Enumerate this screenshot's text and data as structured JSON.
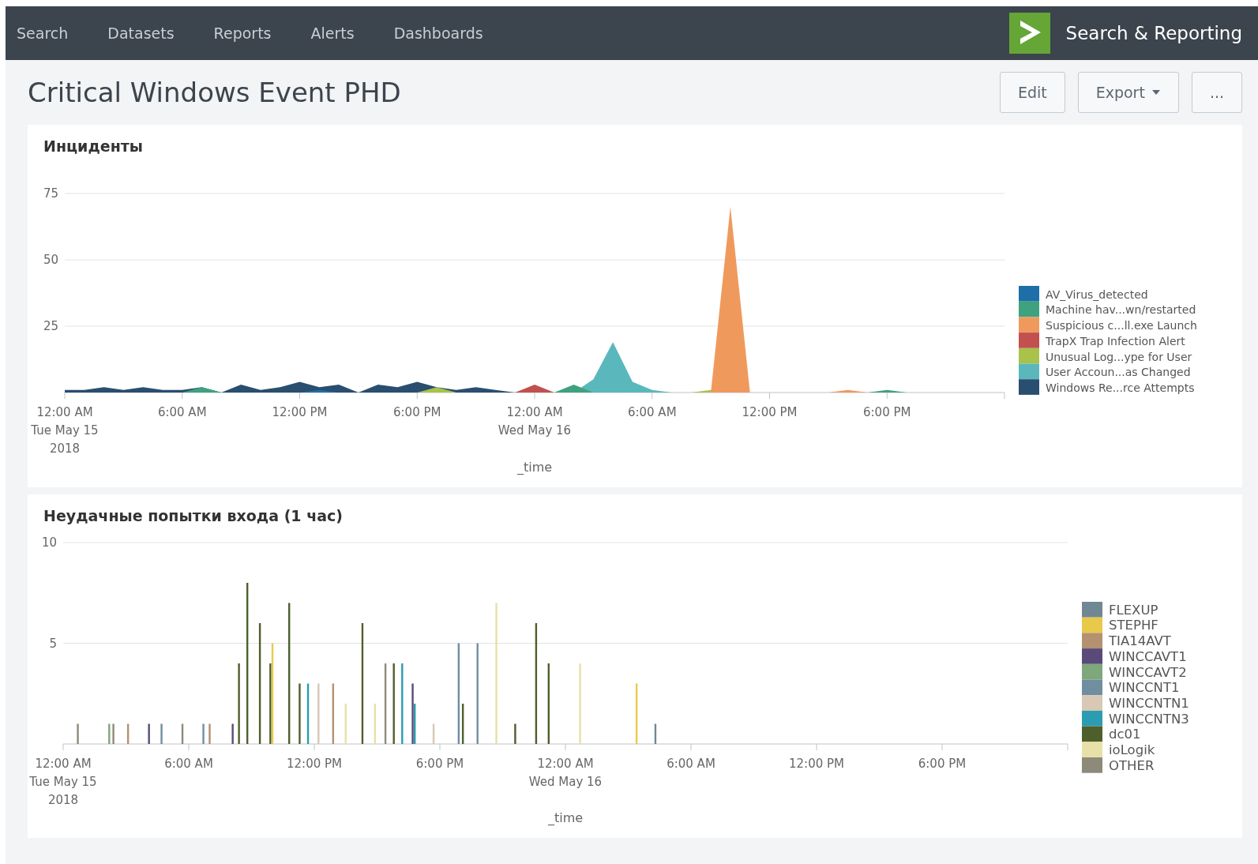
{
  "navbar": {
    "items": [
      {
        "label": "Search"
      },
      {
        "label": "Datasets"
      },
      {
        "label": "Reports"
      },
      {
        "label": "Alerts"
      },
      {
        "label": "Dashboards"
      }
    ],
    "app_name": "Search & Reporting"
  },
  "page": {
    "title": "Critical Windows Event PHD",
    "buttons": [
      {
        "label": "Edit",
        "kind": "plain"
      },
      {
        "label": "Export",
        "kind": "dropdown"
      },
      {
        "label": "...",
        "kind": "plain"
      }
    ]
  },
  "panels": [
    {
      "chart_data": {
        "type": "area",
        "title": "Инциденты",
        "xlabel": "_time",
        "stacked": false,
        "xlim": [
          "2018-05-15T00:00",
          "2018-05-17T00:00"
        ],
        "ylim": [
          0,
          75
        ],
        "yticks": [
          25,
          50,
          75
        ],
        "xticks": [
          {
            "value": "2018-05-15T00:00",
            "label": "12:00 AM\nTue May 15\n2018"
          },
          {
            "value": "2018-05-15T06:00",
            "label": "6:00 AM"
          },
          {
            "value": "2018-05-15T12:00",
            "label": "12:00 PM"
          },
          {
            "value": "2018-05-15T18:00",
            "label": "6:00 PM"
          },
          {
            "value": "2018-05-16T00:00",
            "label": "12:00 AM\nWed May 16"
          },
          {
            "value": "2018-05-16T06:00",
            "label": "6:00 AM"
          },
          {
            "value": "2018-05-16T12:00",
            "label": "12:00 PM"
          },
          {
            "value": "2018-05-16T18:00",
            "label": "6:00 PM"
          }
        ],
        "x": [
          "2018-05-15T00:00",
          "2018-05-15T01:00",
          "2018-05-15T02:00",
          "2018-05-15T03:00",
          "2018-05-15T04:00",
          "2018-05-15T05:00",
          "2018-05-15T06:00",
          "2018-05-15T07:00",
          "2018-05-15T08:00",
          "2018-05-15T09:00",
          "2018-05-15T10:00",
          "2018-05-15T11:00",
          "2018-05-15T12:00",
          "2018-05-15T13:00",
          "2018-05-15T14:00",
          "2018-05-15T15:00",
          "2018-05-15T16:00",
          "2018-05-15T17:00",
          "2018-05-15T18:00",
          "2018-05-15T19:00",
          "2018-05-15T20:00",
          "2018-05-15T21:00",
          "2018-05-15T22:00",
          "2018-05-15T23:00",
          "2018-05-16T00:00",
          "2018-05-16T01:00",
          "2018-05-16T02:00",
          "2018-05-16T03:00",
          "2018-05-16T04:00",
          "2018-05-16T05:00",
          "2018-05-16T06:00",
          "2018-05-16T07:00",
          "2018-05-16T08:00",
          "2018-05-16T09:00",
          "2018-05-16T10:00",
          "2018-05-16T11:00",
          "2018-05-16T15:00",
          "2018-05-16T16:00",
          "2018-05-16T17:00",
          "2018-05-16T18:00",
          "2018-05-16T19:00"
        ],
        "series": [
          {
            "name": "AV_Virus_detected",
            "color": "#1e6fa8",
            "values": [
              null,
              null,
              null,
              null,
              null,
              null,
              null,
              null,
              null,
              null,
              null,
              null,
              0,
              1,
              0,
              null,
              null,
              null,
              null,
              null,
              null,
              null,
              null,
              null,
              null,
              null,
              null,
              null,
              null,
              null,
              null,
              null,
              null,
              null,
              null,
              null,
              null,
              null,
              null,
              null,
              null
            ]
          },
          {
            "name": "Machine hav...wn/restarted",
            "color": "#3ea27e",
            "values": [
              null,
              null,
              null,
              null,
              null,
              null,
              0,
              2,
              0,
              null,
              null,
              null,
              null,
              null,
              null,
              null,
              null,
              null,
              null,
              null,
              null,
              null,
              null,
              null,
              null,
              0,
              3,
              0,
              null,
              null,
              null,
              null,
              null,
              null,
              null,
              null,
              null,
              null,
              0,
              1,
              0
            ]
          },
          {
            "name": "Suspicious c...ll.exe Launch",
            "color": "#ef9a5c",
            "values": [
              null,
              null,
              null,
              null,
              null,
              null,
              null,
              null,
              null,
              null,
              null,
              null,
              null,
              null,
              null,
              null,
              null,
              null,
              null,
              null,
              null,
              null,
              null,
              null,
              null,
              null,
              null,
              null,
              null,
              null,
              null,
              null,
              null,
              0,
              70,
              0,
              0,
              1,
              0,
              null,
              null
            ]
          },
          {
            "name": "TrapX Trap Infection Alert",
            "color": "#c2504f",
            "values": [
              null,
              null,
              null,
              null,
              null,
              null,
              null,
              null,
              null,
              null,
              null,
              null,
              null,
              null,
              null,
              null,
              null,
              null,
              null,
              null,
              null,
              null,
              null,
              0,
              3,
              0,
              null,
              null,
              null,
              null,
              null,
              null,
              null,
              null,
              null,
              null,
              null,
              null,
              null,
              null,
              null
            ]
          },
          {
            "name": "Unusual Log...ype for User",
            "color": "#a8c24a",
            "values": [
              null,
              null,
              null,
              null,
              null,
              null,
              null,
              null,
              null,
              null,
              null,
              null,
              null,
              null,
              null,
              null,
              null,
              null,
              0,
              2,
              0,
              null,
              null,
              null,
              null,
              null,
              null,
              null,
              null,
              null,
              null,
              null,
              0,
              1,
              0,
              null,
              null,
              null,
              null,
              null,
              null
            ]
          },
          {
            "name": "User Accoun...as Changed",
            "color": "#5ab8bd",
            "values": [
              null,
              null,
              null,
              null,
              null,
              null,
              null,
              null,
              null,
              null,
              null,
              null,
              null,
              null,
              null,
              null,
              null,
              null,
              null,
              null,
              null,
              null,
              null,
              null,
              null,
              null,
              0,
              5,
              19,
              4,
              1,
              0,
              null,
              null,
              null,
              null,
              null,
              null,
              null,
              null,
              null
            ]
          },
          {
            "name": "Windows Re...rce Attempts",
            "color": "#294e70",
            "values": [
              1,
              1,
              2,
              1,
              2,
              1,
              1,
              2,
              0,
              3,
              1,
              2,
              4,
              2,
              3,
              0,
              3,
              2,
              4,
              2,
              1,
              2,
              1,
              0,
              null,
              null,
              null,
              null,
              null,
              null,
              null,
              null,
              null,
              null,
              null,
              null,
              null,
              null,
              null,
              null,
              null
            ]
          }
        ],
        "legend": "right"
      }
    },
    {
      "chart_data": {
        "type": "bar",
        "title": "Неудачные попытки входа (1 час)",
        "xlabel": "_time",
        "stacked": true,
        "xlim": [
          "2018-05-15T00:00",
          "2018-05-17T00:00"
        ],
        "ylim": [
          0,
          10
        ],
        "yticks": [
          5,
          10
        ],
        "xticks": [
          {
            "value": "2018-05-15T00:00",
            "label": "12:00 AM\nTue May 15\n2018"
          },
          {
            "value": "2018-05-15T06:00",
            "label": "6:00 AM"
          },
          {
            "value": "2018-05-15T12:00",
            "label": "12:00 PM"
          },
          {
            "value": "2018-05-15T18:00",
            "label": "6:00 PM"
          },
          {
            "value": "2018-05-16T00:00",
            "label": "12:00 AM\nWed May 16"
          },
          {
            "value": "2018-05-16T06:00",
            "label": "6:00 AM"
          },
          {
            "value": "2018-05-16T12:00",
            "label": "12:00 PM"
          },
          {
            "value": "2018-05-16T18:00",
            "label": "6:00 PM"
          }
        ],
        "x": [
          "2018-05-15T00:42",
          "2018-05-15T02:12",
          "2018-05-15T02:24",
          "2018-05-15T03:06",
          "2018-05-15T04:06",
          "2018-05-15T04:42",
          "2018-05-15T05:42",
          "2018-05-15T06:42",
          "2018-05-15T07:00",
          "2018-05-15T08:06",
          "2018-05-15T08:24",
          "2018-05-15T08:48",
          "2018-05-15T09:24",
          "2018-05-15T09:54",
          "2018-05-15T10:00",
          "2018-05-15T10:48",
          "2018-05-15T11:18",
          "2018-05-15T11:42",
          "2018-05-15T12:12",
          "2018-05-15T12:54",
          "2018-05-15T13:30",
          "2018-05-15T14:18",
          "2018-05-15T14:54",
          "2018-05-15T15:24",
          "2018-05-15T15:48",
          "2018-05-15T16:12",
          "2018-05-15T16:42",
          "2018-05-15T16:48",
          "2018-05-15T17:42",
          "2018-05-15T18:54",
          "2018-05-15T19:06",
          "2018-05-15T19:48",
          "2018-05-15T20:42",
          "2018-05-15T21:36",
          "2018-05-15T22:36",
          "2018-05-15T23:12",
          "2018-05-16T00:42",
          "2018-05-16T03:24",
          "2018-05-16T04:18"
        ],
        "series": [
          {
            "name": "FLEXUP",
            "color": "#708794",
            "values": [
              0,
              0,
              0,
              0,
              0,
              0,
              0,
              0,
              0,
              0,
              0,
              0,
              0,
              0,
              0,
              0,
              0,
              0,
              0,
              0,
              0,
              0,
              0,
              0,
              0,
              0,
              0,
              0,
              0,
              0,
              0,
              0,
              0,
              0,
              0,
              0,
              0,
              0,
              1
            ]
          },
          {
            "name": "STEPHF",
            "color": "#e9c94a",
            "values": [
              0,
              0,
              0,
              0,
              0,
              0,
              0,
              0,
              0,
              0,
              0,
              0,
              0,
              0,
              5,
              0,
              0,
              0,
              0,
              0,
              0,
              0,
              0,
              0,
              0,
              0,
              0,
              0,
              0,
              0,
              0,
              0,
              0,
              0,
              0,
              0,
              0,
              3,
              0
            ]
          },
          {
            "name": "TIA14AVT",
            "color": "#b4916f",
            "values": [
              0,
              0,
              0,
              1,
              0,
              0,
              0,
              0,
              1,
              0,
              0,
              0,
              0,
              0,
              0,
              0,
              0,
              0,
              0,
              3,
              0,
              0,
              0,
              0,
              0,
              0,
              0,
              0,
              0,
              0,
              0,
              0,
              0,
              0,
              0,
              0,
              0,
              0,
              0
            ]
          },
          {
            "name": "WINCCAVT1",
            "color": "#5a4a7a",
            "values": [
              0,
              0,
              0,
              0,
              1,
              0,
              0,
              0,
              0,
              1,
              0,
              0,
              0,
              0,
              0,
              0,
              0,
              0,
              0,
              0,
              0,
              0,
              0,
              0,
              0,
              0,
              3,
              0,
              0,
              0,
              0,
              0,
              0,
              0,
              0,
              0,
              0,
              0,
              0
            ]
          },
          {
            "name": "WINCCAVT2",
            "color": "#7ea77b",
            "values": [
              0,
              1,
              0,
              0,
              0,
              0,
              0,
              0,
              0,
              0,
              0,
              0,
              0,
              0,
              0,
              0,
              0,
              0,
              0,
              0,
              0,
              0,
              0,
              0,
              0,
              0,
              0,
              0,
              0,
              0,
              0,
              0,
              0,
              0,
              0,
              0,
              0,
              0,
              0
            ]
          },
          {
            "name": "WINCCNT1",
            "color": "#6f8ea0",
            "values": [
              0,
              0,
              0,
              0,
              0,
              1,
              0,
              1,
              0,
              0,
              0,
              0,
              0,
              0,
              0,
              0,
              0,
              0,
              0,
              0,
              0,
              0,
              0,
              0,
              0,
              0,
              0,
              0,
              0,
              5,
              0,
              5,
              0,
              0,
              0,
              0,
              0,
              0,
              0
            ]
          },
          {
            "name": "WINCCNTN1",
            "color": "#d8c8b4",
            "values": [
              0,
              0,
              0,
              0,
              0,
              0,
              0,
              0,
              0,
              0,
              0,
              0,
              0,
              0,
              0,
              0,
              0,
              0,
              3,
              0,
              0,
              0,
              0,
              0,
              0,
              0,
              0,
              0,
              1,
              0,
              0,
              0,
              0,
              0,
              0,
              0,
              0,
              0,
              0
            ]
          },
          {
            "name": "WINCCNTN3",
            "color": "#2c9cb0",
            "values": [
              0,
              0,
              0,
              0,
              0,
              0,
              0,
              0,
              0,
              0,
              0,
              0,
              0,
              0,
              0,
              0,
              0,
              3,
              0,
              0,
              0,
              0,
              0,
              0,
              0,
              4,
              0,
              2,
              0,
              0,
              0,
              0,
              0,
              0,
              0,
              0,
              0,
              0,
              0
            ]
          },
          {
            "name": "dc01",
            "color": "#4f5f2b",
            "values": [
              0,
              0,
              0,
              0,
              0,
              0,
              0,
              0,
              0,
              0,
              4,
              8,
              6,
              4,
              0,
              7,
              3,
              0,
              0,
              0,
              0,
              6,
              0,
              0,
              4,
              0,
              0,
              0,
              0,
              0,
              2,
              0,
              0,
              1,
              6,
              4,
              0,
              0,
              0
            ]
          },
          {
            "name": "ioLogik",
            "color": "#e8e0a8",
            "values": [
              0,
              0,
              0,
              0,
              0,
              0,
              0,
              0,
              0,
              0,
              0,
              0,
              0,
              0,
              0,
              0,
              0,
              0,
              0,
              0,
              2,
              0,
              2,
              0,
              0,
              0,
              0,
              0,
              0,
              0,
              0,
              0,
              7,
              0,
              0,
              0,
              4,
              0,
              0
            ]
          },
          {
            "name": "OTHER",
            "color": "#8e8a7a",
            "values": [
              1,
              0,
              1,
              0,
              0,
              0,
              1,
              0,
              0,
              0,
              0,
              0,
              0,
              0,
              0,
              0,
              0,
              0,
              0,
              0,
              0,
              0,
              0,
              4,
              0,
              0,
              0,
              0,
              0,
              0,
              0,
              0,
              0,
              0,
              0,
              0,
              0,
              0,
              0
            ]
          }
        ],
        "legend": "right"
      }
    }
  ]
}
